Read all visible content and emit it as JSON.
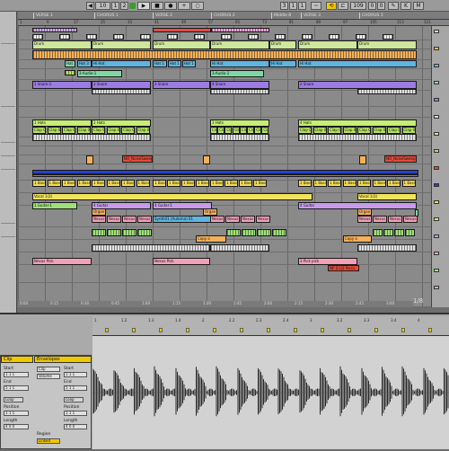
{
  "transport": {
    "tempo": "10",
    "signature_a": "1",
    "signature_b": "2",
    "position_a": "3",
    "position_b": "1",
    "position_c": "1",
    "end_value": "109",
    "end_b": "0",
    "end_c": "0"
  },
  "sections": [
    "VERSE 1",
    "CHORUS 1",
    "VERSE 2",
    "CHORUS 2",
    "Middle 8",
    "VERSE 3",
    "CHORUS 3"
  ],
  "ruler": [
    "1",
    "9",
    "17",
    "25",
    "33",
    "41",
    "49",
    "57",
    "65",
    "73",
    "81",
    "89",
    "97",
    "105",
    "113",
    "121"
  ],
  "timecodes": [
    "0:00",
    "0:15",
    "0:30",
    "0:45",
    "1:00",
    "1:15",
    "1:30",
    "1:45",
    "2:00",
    "2:15",
    "2:30",
    "2:45",
    "3:00"
  ],
  "clips": {
    "drum": "Drum",
    "hihat": "Hat 3",
    "hihat2": "Hat 1",
    "hihat3": "Hi Hat",
    "audio": "3-Audio-1",
    "snare1": "1 Snare-1",
    "snare2": "2 Snare",
    "snare3": "3 Snare",
    "snare4": "4 Snare",
    "hats1": "1 Hats",
    "hats2": "2 Hats",
    "hats3": "3 Hats",
    "hats4": "4 Hats",
    "clap": "Clap 01",
    "notes": "NO_NoiseSweep",
    "bass": "1 Bass",
    "vocal": "Vocal 1(3)",
    "guitar1": "1 Guitar-1",
    "guitar4": "4 Guitar",
    "guitar4b": "4 Guitar-1",
    "synth": "Synth01 (Automa) 01",
    "nexus": "Nexus Pick",
    "nexus2": "3 Pick pick",
    "nexusPercs": "NP D LD Percs",
    "copy": "Copy o",
    "organ": "Organ"
  },
  "lower_ruler": [
    "1",
    "1.2",
    "1.3",
    "1.4",
    "2",
    "2.2",
    "2.3",
    "2.4",
    "3",
    "3.2",
    "3.3",
    "3.4",
    "4"
  ],
  "clip_panel": {
    "header": "Envelopes",
    "start_label": "Start",
    "end_label": "End",
    "loop_label": "Loop",
    "position_label": "Position",
    "length_label": "Length",
    "region_label": "Region",
    "linked_label": "Linked",
    "device_choice": "Clip",
    "control_choice": "Volume",
    "start_value": "1 1 1",
    "end_value": "5 1 1",
    "position_value": "1 1 1",
    "length_value": "4 0 0",
    "tab_label": "Clip"
  },
  "overview_label": "1/8",
  "colors": {
    "drum": "#cfe79a",
    "hat": "#5fb5e0",
    "snare": "#9c7be2",
    "hats": "#c6ef74",
    "clap": "#b7e35f",
    "noise": "#e74a38",
    "bass": "#f2dc55",
    "vocal": "#f2e35e",
    "guitar": "#c79bea",
    "green": "#9ee07a",
    "pink": "#f2a0b8",
    "selection": "#f0c800"
  }
}
